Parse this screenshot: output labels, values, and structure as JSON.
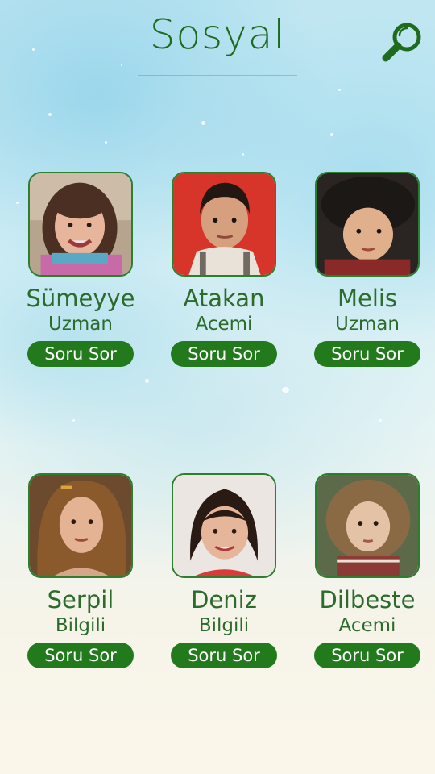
{
  "header": {
    "title": "Sosyal",
    "search_icon": "search-icon"
  },
  "colors": {
    "accent": "#237a1d",
    "text": "#2c6b2c"
  },
  "users": [
    {
      "name": "Sümeyye",
      "level": "Uzman",
      "button": "Soru Sor"
    },
    {
      "name": "Atakan",
      "level": "Acemi",
      "button": "Soru Sor"
    },
    {
      "name": "Melis",
      "level": "Uzman",
      "button": "Soru Sor"
    },
    {
      "name": "Serpil",
      "level": "Bilgili",
      "button": "Soru Sor"
    },
    {
      "name": "Deniz",
      "level": "Bilgili",
      "button": "Soru Sor"
    },
    {
      "name": "Dilbeste",
      "level": "Acemi",
      "button": "Soru Sor"
    }
  ]
}
